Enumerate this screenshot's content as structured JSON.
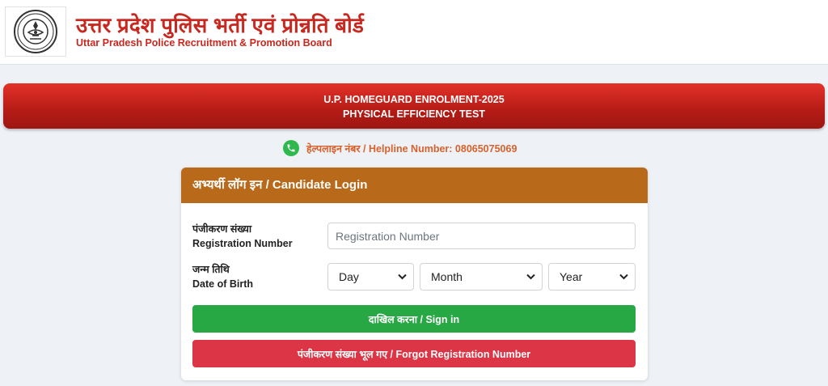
{
  "header": {
    "title_hi": "उत्तर प्रदेश पुलिस भर्ती एवं प्रोन्नति बोर्ड",
    "title_en": "Uttar Pradesh Police Recruitment & Promotion Board",
    "logo_icon": "up-police-emblem-icon"
  },
  "banner": {
    "line1": "U.P. HOMEGUARD ENROLMENT-2025",
    "line2": "PHYSICAL EFFICIENCY TEST"
  },
  "helpline": {
    "icon": "phone-icon",
    "text": "हेल्पलाइन नंबर / Helpline Number: 08065075069"
  },
  "login": {
    "title": "अभ्यर्थी लॉग इन / Candidate Login",
    "reg_label_hi": "पंजीकरण संख्या",
    "reg_label_en": "Registration Number",
    "reg_placeholder": "Registration Number",
    "reg_value": "",
    "dob_label_hi": "जन्म तिथि",
    "dob_label_en": "Date of Birth",
    "day_selected": "Day",
    "month_selected": "Month",
    "year_selected": "Year",
    "signin_label": "दाखिल करना / Sign in",
    "forgot_label": "पंजीकरण संख्या भूल गए / Forgot Registration Number"
  },
  "colors": {
    "brand_red": "#c7281f",
    "banner_red": "#b51b15",
    "card_header": "#b86a1a",
    "helpline": "#d8612b",
    "signin_green": "#28a745",
    "forgot_red": "#dc3545"
  }
}
